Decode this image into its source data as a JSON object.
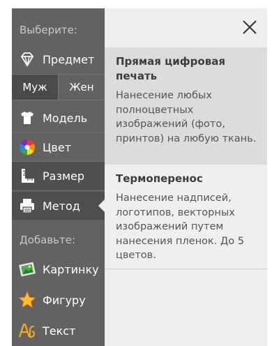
{
  "sidebar": {
    "choose_label": "Выберите:",
    "add_label": "Добавьте:",
    "subject": {
      "label": "Предмет",
      "icon": "diamond-icon"
    },
    "gender": {
      "male": "Муж",
      "female": "Жен",
      "selected": "Муж"
    },
    "items": [
      {
        "label": "Модель",
        "icon": "tshirt-icon"
      },
      {
        "label": "Цвет",
        "icon": "color-wheel-icon"
      },
      {
        "label": "Размер",
        "icon": "ruler-icon"
      },
      {
        "label": "Метод",
        "icon": "printer-icon"
      }
    ],
    "add_items": [
      {
        "label": "Картинку",
        "icon": "picture-icon"
      },
      {
        "label": "Фигуру",
        "icon": "star-icon"
      },
      {
        "label": "Текст",
        "icon": "text-icon"
      }
    ],
    "selected": "Метод"
  },
  "panel": {
    "options": [
      {
        "title": "Прямая цифровая печать",
        "description": "Нанесение любых полноцветных изображений (фото, принтов) на любую ткань.",
        "highlighted": true
      },
      {
        "title": "Термоперенос",
        "description": "Нанесение надписей, логотипов, векторных изображений путем нанесения пленок. До 5 цветов.",
        "highlighted": false
      }
    ]
  },
  "colors": {
    "sidebar_bg": "#626262",
    "sidebar_selected_bg": "#4f4f4f",
    "panel_bg": "#efefef",
    "highlight_bg": "#dcdcdc"
  }
}
